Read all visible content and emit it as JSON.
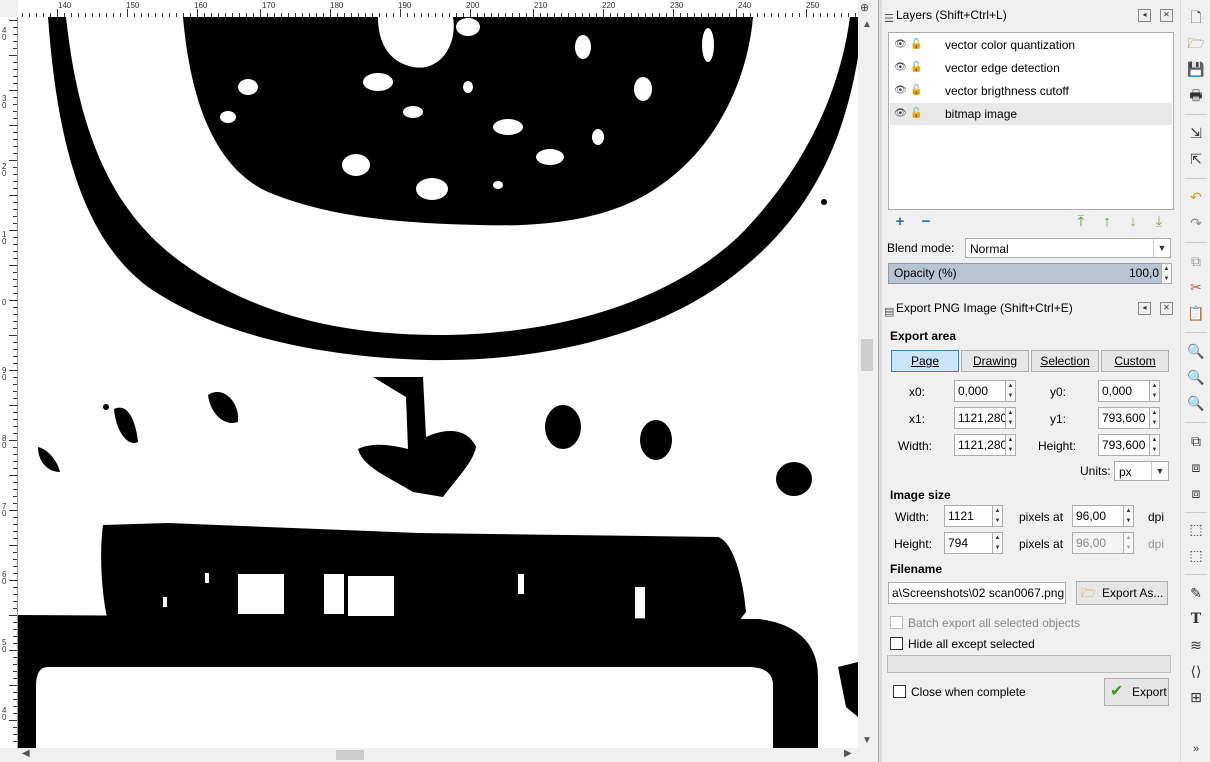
{
  "ruler": {
    "h_labels": [
      "140",
      "150",
      "160",
      "170",
      "180",
      "190",
      "200",
      "210",
      "220",
      "230",
      "240",
      "250"
    ],
    "v_labels": [
      "40",
      "30",
      "20",
      "10",
      "0",
      "90",
      "80",
      "70",
      "60",
      "50",
      "40"
    ]
  },
  "layers_panel": {
    "title": "Layers (Shift+Ctrl+L)",
    "layers": [
      {
        "name": "vector color quantization"
      },
      {
        "name": "vector edge detection"
      },
      {
        "name": "vector brigthness cutoff"
      },
      {
        "name": "bitmap image"
      }
    ],
    "blend_label": "Blend mode:",
    "blend_value": "Normal",
    "opacity_label": "Opacity (%)",
    "opacity_value": "100,0"
  },
  "export_panel": {
    "title": "Export PNG Image (Shift+Ctrl+E)",
    "export_area_label": "Export area",
    "area_buttons": [
      "Page",
      "Drawing",
      "Selection",
      "Custom"
    ],
    "x0_label": "x0:",
    "x0": "0,000",
    "y0_label": "y0:",
    "y0": "0,000",
    "x1_label": "x1:",
    "x1": "1121,280",
    "y1_label": "y1:",
    "y1": "793,600",
    "width_label": "Width:",
    "width": "1121,280",
    "height_label": "Height:",
    "height": "793,600",
    "units_label": "Units:",
    "units": "px",
    "image_size_label": "Image size",
    "img_width_label": "Width:",
    "img_width": "1121",
    "img_height_label": "Height:",
    "img_height": "794",
    "pixels_at": "pixels at",
    "dpi_x": "96,00",
    "dpi_y": "96,00",
    "dpi": "dpi",
    "filename_label": "Filename",
    "filename": "a\\Screenshots\\02 scan0067.png",
    "export_as": "Export As...",
    "batch_export": "Batch export all selected objects",
    "hide_all": "Hide all except selected",
    "close_when_complete": "Close when complete",
    "export": "Export"
  },
  "colors": {
    "accent": "#3c7fb1",
    "selected_segment": "#cce4f7",
    "opacity_bar": "#b8c4cf"
  }
}
